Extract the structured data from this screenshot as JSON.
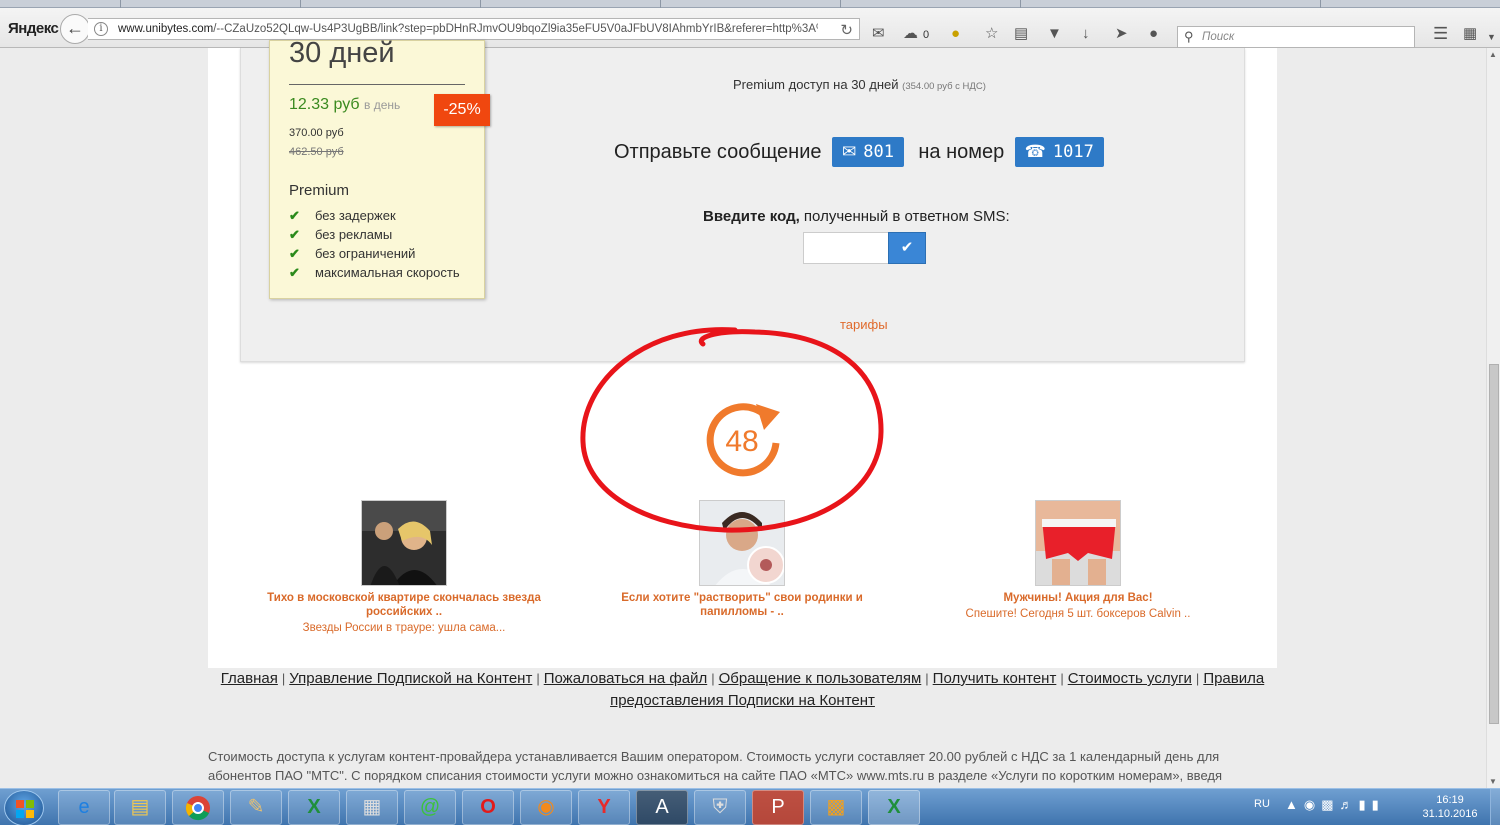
{
  "browser": {
    "logo": "Яндекс",
    "url_host": "www.unibytes.com",
    "url_rest": "/--CZaUzo52QLqw-Us4P3UgBB/link?step=pbDHnRJmvOU9bqoZl9ia35eFU5V0aJFbUV8IAhmbYrIB&referer=http%3A%2F",
    "badge_count": "0",
    "search_placeholder": "Поиск"
  },
  "tariff": {
    "period": "30 дней",
    "price_per_day": "12.33 руб",
    "per_day_label": "в день",
    "discount": "-25%",
    "total": "370.00 руб",
    "old_price": "462.50 руб",
    "plan_name": "Premium",
    "features": [
      "без задержек",
      "без рекламы",
      "без ограничений",
      "максимальная скорость"
    ]
  },
  "sms": {
    "premium_access": "Premium доступ на 30 дней",
    "vat_note": "(354.00 руб с НДС)",
    "send_label": "Отправьте сообщение",
    "message_code": "801",
    "to_number_label": "на номер",
    "short_number": "1017",
    "code_label_bold": "Введите код,",
    "code_label_rest": " полученный в ответном SMS:",
    "code_value": "",
    "tariffs_link": "тарифы"
  },
  "timer": {
    "seconds": "48"
  },
  "news": [
    {
      "title": "Тихо в московской квартире скончалась звезда российских ..",
      "subtitle": "Звезды России в трауре: ушла сама..."
    },
    {
      "title": "Если хотите \"растворить\" свои родинки и папилломы - ..",
      "subtitle": ""
    },
    {
      "title": "Мужчины! Акция для Вас!",
      "subtitle": "Спешите! Сегодня 5 шт. боксеров Calvin .."
    }
  ],
  "footer": {
    "links": [
      "Главная",
      "Управление Подпиской на Контент",
      "Пожаловаться на файл",
      "Обращение к пользователям",
      "Получить контент",
      "Стоимость услуги",
      "Правила предоставления Подписки на Контент"
    ],
    "notice": "Стоимость доступа к услугам контент-провайдера устанавливается Вашим оператором. Стоимость услуги составляет 20.00 рублей с НДС за 1 календарный день для абонентов ПАО \"МТС\". С порядком списания стоимости услуги можно ознакомиться на сайте ПАО «МТС» www.mts.ru в разделе «Услуги по коротким номерам», введя"
  },
  "taskbar": {
    "apps": [
      "ie-icon",
      "explorer-icon",
      "chrome-icon",
      "paint-icon",
      "excel-icon",
      "calculator-icon",
      "icq-icon",
      "opera-icon",
      "firefox-icon",
      "yandex-browser-icon",
      "acrobat-icon",
      "world-of-tanks-icon",
      "powerpoint-icon",
      "media-icon",
      "excel-icon"
    ],
    "lang": "RU",
    "time": "16:19",
    "date": "31.10.2016"
  },
  "colors": {
    "accent_blue": "#2e7ac7",
    "discount_orange": "#f0470f",
    "price_green": "#3a8a1f",
    "link_orange": "#e06a2c",
    "annotation_red": "#e8141a"
  }
}
